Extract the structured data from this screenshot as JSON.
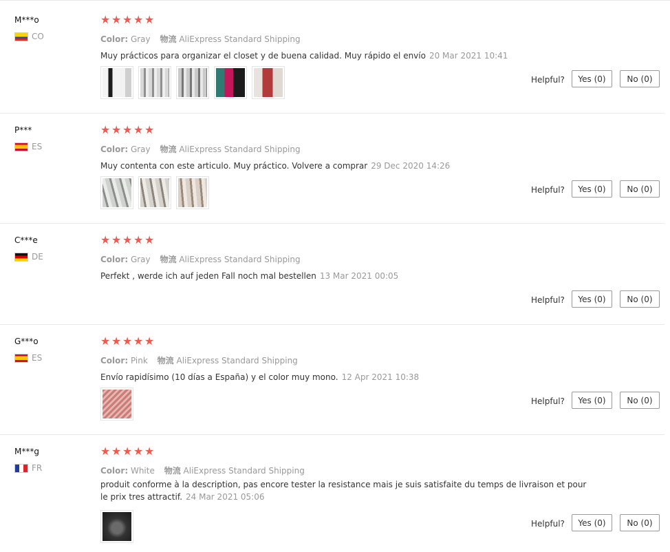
{
  "labels": {
    "color": "Color:",
    "shipping": "物流",
    "helpful": "Helpful?"
  },
  "reviews": [
    {
      "name": "M***o",
      "country": "CO",
      "flag_colors": [
        "#f8d313",
        "#1f4fa0",
        "#d22f27"
      ],
      "stars": 5,
      "color_value": "Gray",
      "shipping_value": "AliExpress Standard Shipping",
      "text": "Muy prácticos para organizar el closet y de buena calidad. Muy rápido el envío",
      "date": "20 Mar 2021 10:41",
      "photos": [
        "white-bag-photo",
        "hanger-photo",
        "hanger-photo",
        "clothes-photo",
        "clothes-photo"
      ],
      "yes": "Yes (0)",
      "no": "No (0)"
    },
    {
      "name": "P***",
      "country": "ES",
      "flag_colors": [
        "#c8102e",
        "#ffc400",
        "#c8102e"
      ],
      "stars": 5,
      "color_value": "Gray",
      "shipping_value": "AliExpress Standard Shipping",
      "text": "Muy contenta con este articulo. Muy práctico. Volvere a comprar",
      "date": "29 Dec 2020 14:26",
      "photos": [
        "hanger-photo",
        "hanger-photo",
        "hanger-photo"
      ],
      "yes": "Yes (0)",
      "no": "No (0)"
    },
    {
      "name": "C***e",
      "country": "DE",
      "flag_colors": [
        "#111111",
        "#dd0000",
        "#ffce00"
      ],
      "stars": 5,
      "color_value": "Gray",
      "shipping_value": "AliExpress Standard Shipping",
      "text": "Perfekt , werde ich auf jeden Fall noch mal bestellen",
      "date": "13 Mar 2021 00:05",
      "photos": [],
      "yes": "Yes (0)",
      "no": "No (0)"
    },
    {
      "name": "G***o",
      "country": "ES",
      "flag_colors": [
        "#c8102e",
        "#ffc400",
        "#c8102e"
      ],
      "stars": 5,
      "color_value": "Pink",
      "shipping_value": "AliExpress Standard Shipping",
      "text": "Envío rapidísimo (10 días a España) y el color muy mono.",
      "date": "12 Apr 2021 10:38",
      "photos": [
        "pink-package-photo"
      ],
      "yes": "Yes (0)",
      "no": "No (0)"
    },
    {
      "name": "M***g",
      "country": "FR",
      "flag_colors": [
        "#1f3d99",
        "#ffffff",
        "#e0222a"
      ],
      "stars": 5,
      "color_value": "White",
      "shipping_value": "AliExpress Standard Shipping",
      "text": "produit conforme à la description, pas encore tester la resistance mais je suis satisfaite du temps de livraison et pour le prix tres attractif.",
      "date": "24 Mar 2021 05:06",
      "photos": [
        "dark-bag-photo"
      ],
      "yes": "Yes (0)",
      "no": "No (0)"
    }
  ]
}
